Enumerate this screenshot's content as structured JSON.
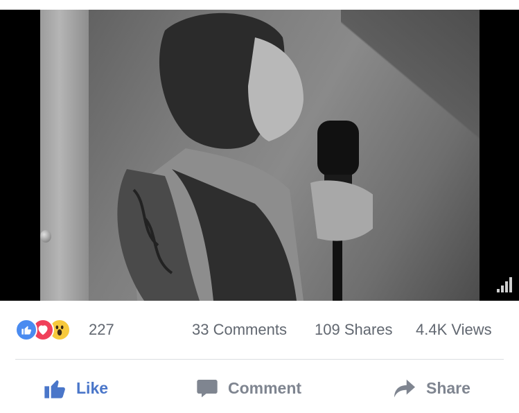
{
  "video": {
    "icons": {
      "signal": "signal-strength-icon"
    }
  },
  "stats": {
    "reaction_icons": [
      "like-reaction-icon",
      "love-reaction-icon",
      "wow-reaction-icon"
    ],
    "reaction_count": "227",
    "comments": "33 Comments",
    "shares": "109 Shares",
    "views": "4.4K Views"
  },
  "actions": {
    "like_label": "Like",
    "comment_label": "Comment",
    "share_label": "Share"
  },
  "colors": {
    "like_blue": "#4a76c9",
    "reaction_like": "#4a8bf0",
    "reaction_love": "#f0405a",
    "reaction_wow": "#f7c93c",
    "secondary_text": "#616770"
  }
}
